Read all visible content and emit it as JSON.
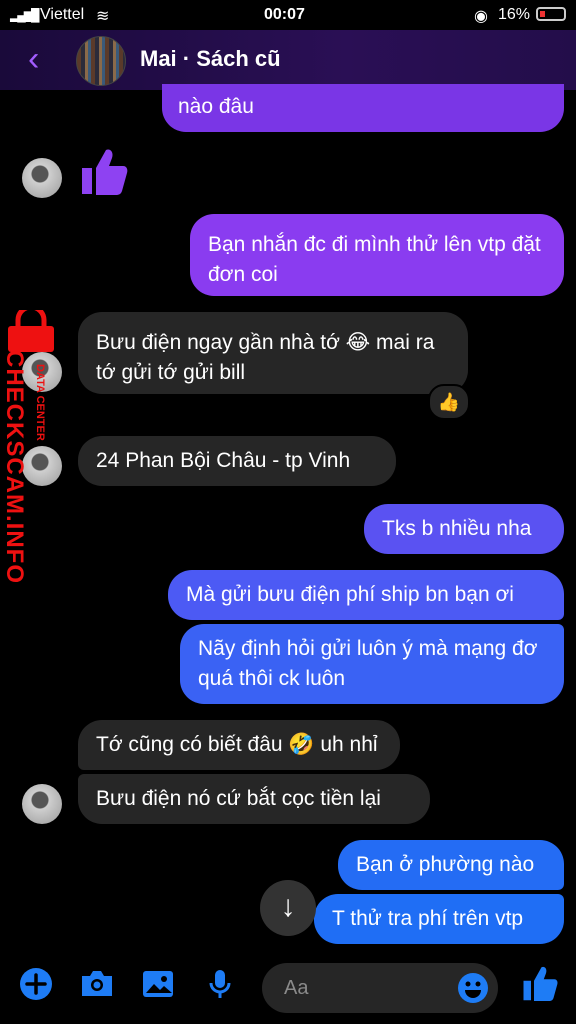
{
  "status": {
    "carrier": "Viettel",
    "time": "00:07",
    "battery": "16%"
  },
  "header": {
    "contact": "Mai · Sách cũ"
  },
  "messages": {
    "m0": "nào đâu",
    "m1": "Bạn nhắn đc đi mình thử lên vtp đặt đơn coi",
    "m2": "Bưu điện ngay gần nhà tớ 😂 mai ra tớ gửi tớ gửi bill",
    "m3": "24 Phan Bội Châu - tp Vinh",
    "m4": "Tks b nhiều nha",
    "m5": "Mà gửi bưu điện phí ship bn bạn ơi",
    "m6": "Nãy định hỏi gửi luôn ý mà mạng đơ quá thôi ck luôn",
    "m7": "Tớ cũng có biết đâu 🤣 uh nhỉ",
    "m8": "Bưu điện nó cứ bắt cọc tiền lại",
    "m9": "Bạn ở phường nào",
    "m10": "T thử tra phí trên vtp"
  },
  "reaction": "👍",
  "composer": {
    "placeholder": "Aa"
  },
  "watermark": {
    "main": "CHECKSCAM.INFO",
    "sub": "DATA CENTER"
  },
  "colors": {
    "outgoing_top": "#8a3cf0",
    "outgoing_bottom": "#1f6ef5",
    "incoming": "#262626",
    "accent": "#a25cff"
  }
}
